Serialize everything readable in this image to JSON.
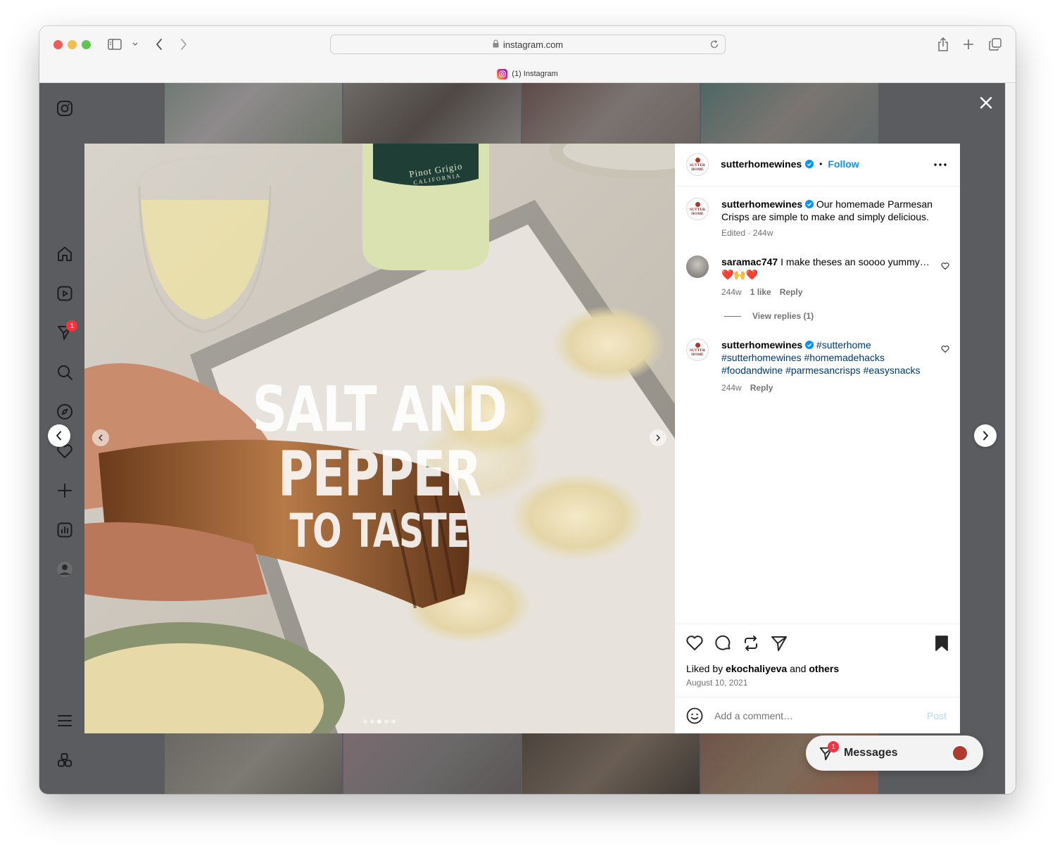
{
  "browser": {
    "url": "instagram.com",
    "tab_title": "(1) Instagram",
    "colors": {
      "close": "#ec5f57",
      "minimize": "#f4be4f",
      "zoom": "#61c554"
    }
  },
  "sidebar": {
    "items": [
      {
        "name": "instagram-logo-icon"
      },
      {
        "name": "home-icon"
      },
      {
        "name": "reels-icon"
      },
      {
        "name": "messages-icon",
        "badge": "1"
      },
      {
        "name": "search-icon"
      },
      {
        "name": "explore-icon"
      },
      {
        "name": "notifications-icon"
      },
      {
        "name": "create-icon"
      },
      {
        "name": "insights-icon"
      },
      {
        "name": "profile-icon"
      },
      {
        "name": "menu-icon"
      },
      {
        "name": "apps-icon"
      }
    ]
  },
  "post": {
    "image_text": {
      "line1": "SALT AND PEPPER",
      "line2": "TO TASTE"
    },
    "bottle_label": {
      "line1": "Pinot Grigio",
      "line2": "CALIFORNIA"
    },
    "carousel_dots": 5,
    "active_dot": 3,
    "header": {
      "username": "sutterhomewines",
      "separator": "•",
      "follow_label": "Follow",
      "avatar_text_top": "SUTTER",
      "avatar_text_bottom": "HOME"
    },
    "caption": {
      "username": "sutterhomewines",
      "text": "Our homemade Parmesan Crisps are simple to make and simply delicious.",
      "meta": "Edited · 244w"
    },
    "comments": [
      {
        "username": "saramac747",
        "text": "I make theses an soooo yummy…❤️🙌❤️",
        "time": "244w",
        "likes": "1 like",
        "reply_label": "Reply",
        "view_replies": "View replies (1)"
      },
      {
        "username": "sutterhomewines",
        "hashtags": "#sutterhome #sutterhomewines #homemadehacks #foodandwine #parmesancrisps #easysnacks",
        "time": "244w",
        "reply_label": "Reply"
      }
    ],
    "liked_by_prefix": "Liked by",
    "liked_by_user": "ekochaliyeva",
    "liked_by_and": "and",
    "liked_by_others": "others",
    "date": "August 10, 2021",
    "comment_placeholder": "Add a comment…",
    "post_label": "Post"
  },
  "messages_pill": {
    "label": "Messages",
    "badge": "1"
  },
  "accent": {
    "follow": "#0095f6",
    "badge": "#ff3040",
    "hashtag": "#00376b"
  }
}
